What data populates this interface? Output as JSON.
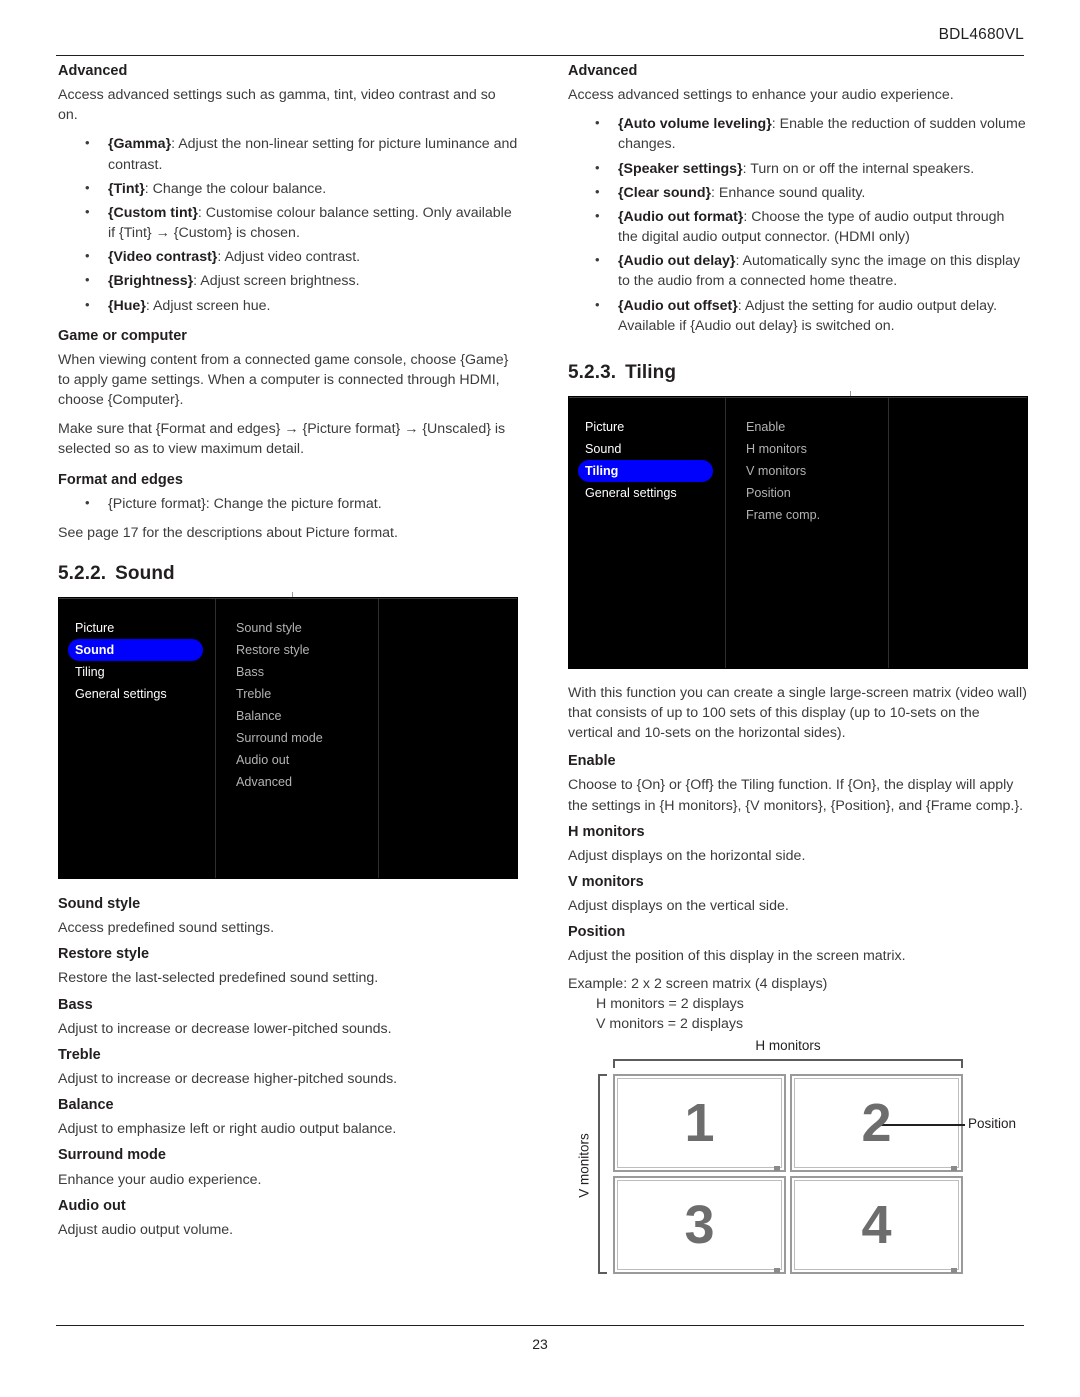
{
  "header": {
    "model": "BDL4680VL"
  },
  "footer": {
    "page_number": "23"
  },
  "left_column": {
    "advanced": {
      "heading": "Advanced",
      "intro": "Access advanced settings such as gamma, tint, video contrast and so on.",
      "bullets": [
        {
          "term": "{Gamma}",
          "rest": ": Adjust the non-linear setting for picture luminance and contrast."
        },
        {
          "term": "{Tint}",
          "rest": ": Change the colour balance."
        },
        {
          "term": "{Custom tint}",
          "rest": ": Customise colour balance setting. Only available if {Tint} → {Custom} is chosen."
        },
        {
          "term": "{Video contrast}",
          "rest": ": Adjust video contrast."
        },
        {
          "term": "{Brightness}",
          "rest": ": Adjust screen brightness."
        },
        {
          "term": "{Hue}",
          "rest": ": Adjust screen hue."
        }
      ]
    },
    "game_or_computer": {
      "heading": "Game or computer",
      "para1": "When viewing content from a connected game console, choose {Game} to apply game settings. When a computer is connected through HDMI, choose {Computer}.",
      "para2": "Make sure that {Format and edges} → {Picture format} → {Unscaled} is selected so as to view maximum detail."
    },
    "format_and_edges": {
      "heading": "Format and edges",
      "bullet": "{Picture format}: Change the picture format.",
      "note": "See page 17 for the descriptions about Picture format."
    },
    "sound_section": {
      "number": "5.2.2.",
      "title": "Sound"
    },
    "sound_osd": {
      "menu_items": [
        "Picture",
        "Sound",
        "Tiling",
        "General settings"
      ],
      "selected": "Sound",
      "options": [
        "Sound style",
        "Restore style",
        "Bass",
        "Treble",
        "Balance",
        "Surround mode",
        "Audio out",
        "Advanced"
      ]
    },
    "definitions": [
      {
        "term": "Sound style",
        "desc": "Access predefined sound settings."
      },
      {
        "term": "Restore style",
        "desc": "Restore the last-selected predefined sound setting."
      },
      {
        "term": "Bass",
        "desc": "Adjust to increase or decrease lower-pitched sounds."
      },
      {
        "term": "Treble",
        "desc": "Adjust to increase or decrease higher-pitched sounds."
      },
      {
        "term": "Balance",
        "desc": "Adjust to emphasize left or right audio output balance."
      },
      {
        "term": "Surround mode",
        "desc": "Enhance your audio experience."
      },
      {
        "term": "Audio out",
        "desc": "Adjust audio output volume."
      }
    ]
  },
  "right_column": {
    "advanced": {
      "heading": "Advanced",
      "intro": "Access advanced settings to enhance your audio experience.",
      "bullets": [
        {
          "term": "{Auto volume leveling}",
          "rest": ": Enable the reduction of sudden volume changes."
        },
        {
          "term": "{Speaker settings}",
          "rest": ": Turn on or off the internal speakers."
        },
        {
          "term": "{Clear sound}",
          "rest": ": Enhance sound quality."
        },
        {
          "term": "{Audio out format}",
          "rest": ": Choose the type of audio output through the digital audio output connector. (HDMI only)"
        },
        {
          "term": "{Audio out delay}",
          "rest": ": Automatically sync the image on this display to the audio from a connected home theatre."
        },
        {
          "term": "{Audio out offset}",
          "rest": ": Adjust the setting for audio output delay. Available if {Audio out delay} is switched on."
        }
      ]
    },
    "tiling_section": {
      "number": "5.2.3.",
      "title": "Tiling"
    },
    "tiling_osd": {
      "menu_items": [
        "Picture",
        "Sound",
        "Tiling",
        "General settings"
      ],
      "selected": "Tiling",
      "options": [
        "Enable",
        "H monitors",
        "V monitors",
        "Position",
        "Frame comp."
      ]
    },
    "tiling_intro": "With this function you can create a single large-screen matrix (video wall) that consists of up to 100 sets of this display (up to 10-sets on the vertical and 10-sets on the horizontal sides).",
    "definitions": [
      {
        "term": "Enable",
        "desc": "Choose to {On} or {Off} the Tiling function. If {On}, the display will apply the settings in {H monitors}, {V monitors}, {Position}, and {Frame comp.}."
      },
      {
        "term": "H monitors",
        "desc": "Adjust displays on the horizontal side."
      },
      {
        "term": "V monitors",
        "desc": "Adjust displays on the vertical side."
      },
      {
        "term": "Position",
        "desc": "Adjust the position of this display in the screen matrix."
      }
    ],
    "example": {
      "title": "Example: 2 x 2 screen matrix (4 displays)",
      "line1": "H monitors = 2 displays",
      "line2": "V monitors = 2 displays"
    },
    "diagram": {
      "h_label": "H monitors",
      "v_label": "V monitors",
      "position_label": "Position",
      "cells": [
        "1",
        "2",
        "3",
        "4"
      ]
    }
  }
}
